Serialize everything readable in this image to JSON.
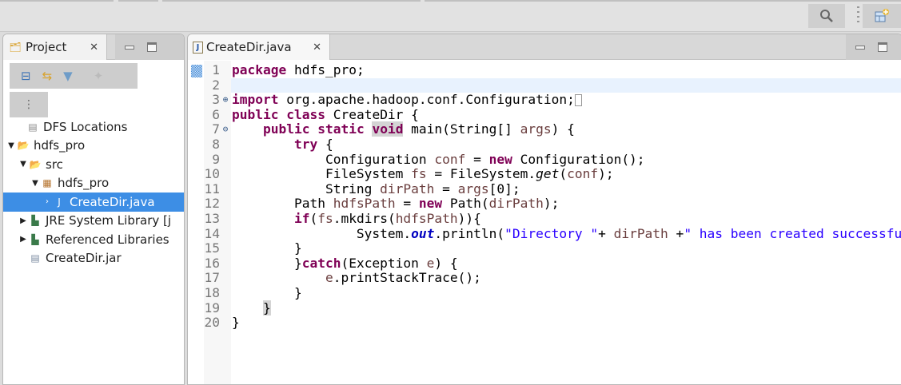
{
  "toolbar": {
    "search_icon": "search-icon",
    "perspective_icon": "open-perspective-icon"
  },
  "project_panel": {
    "tab_label": "Project",
    "close_icon": "close-icon",
    "tools": [
      "collapse-all-icon",
      "link-with-editor-icon",
      "filter-icon",
      "disabled-action-icon"
    ],
    "view_menu_icon": "view-menu-icon",
    "tree": [
      {
        "label": "DFS Locations",
        "level": 0,
        "arrow": "",
        "icon": "dfs-icon"
      },
      {
        "label": "hdfs_pro",
        "level": 0,
        "arrow": "▼",
        "icon": "project-folder-icon"
      },
      {
        "label": "src",
        "level": 1,
        "arrow": "▼",
        "icon": "source-folder-icon"
      },
      {
        "label": "hdfs_pro",
        "level": 2,
        "arrow": "▼",
        "icon": "package-icon"
      },
      {
        "label": "CreateDir.java",
        "level": 3,
        "arrow": "›",
        "icon": "java-file-icon",
        "selected": true
      },
      {
        "label": "JRE System Library [j",
        "level": 1,
        "arrow": "▶",
        "icon": "library-icon"
      },
      {
        "label": "Referenced Libraries",
        "level": 1,
        "arrow": "▶",
        "icon": "library-icon"
      },
      {
        "label": "CreateDir.jar",
        "level": 1,
        "arrow": "",
        "icon": "jar-file-icon"
      }
    ]
  },
  "editor": {
    "tab_label": "CreateDir.java",
    "current_line": "2",
    "lines": [
      {
        "n": "1",
        "fold": "",
        "t": [
          [
            "package",
            "kw"
          ],
          [
            " hdfs_pro;",
            ""
          ]
        ]
      },
      {
        "n": "2",
        "fold": "",
        "t": []
      },
      {
        "n": "3",
        "fold": "⊕",
        "t": [
          [
            "import",
            "kw"
          ],
          [
            " org.apache.hadoop.conf.Configuration;",
            ""
          ],
          [
            "",
            "box"
          ]
        ]
      },
      {
        "n": "6",
        "fold": "",
        "t": [
          [
            "public",
            "kw"
          ],
          [
            " ",
            ""
          ],
          [
            "class",
            "kw"
          ],
          [
            " CreateDir {",
            ""
          ]
        ]
      },
      {
        "n": "7",
        "fold": "⊖",
        "t": [
          [
            "    ",
            ""
          ],
          [
            "public",
            "kw"
          ],
          [
            " ",
            ""
          ],
          [
            "static",
            "kw"
          ],
          [
            " ",
            ""
          ],
          [
            "void",
            "kw occ"
          ],
          [
            " main(String[] ",
            ""
          ],
          [
            "args",
            "var"
          ],
          [
            ") {",
            ""
          ]
        ]
      },
      {
        "n": "8",
        "fold": "",
        "t": [
          [
            "        ",
            ""
          ],
          [
            "try",
            "kw"
          ],
          [
            " {",
            ""
          ]
        ]
      },
      {
        "n": "9",
        "fold": "",
        "t": [
          [
            "            Configuration ",
            ""
          ],
          [
            "conf",
            "var"
          ],
          [
            " = ",
            ""
          ],
          [
            "new",
            "kw"
          ],
          [
            " Configuration();",
            ""
          ]
        ]
      },
      {
        "n": "10",
        "fold": "",
        "t": [
          [
            "            FileSystem ",
            ""
          ],
          [
            "fs",
            "var"
          ],
          [
            " = FileSystem.",
            ""
          ],
          [
            "get",
            "it"
          ],
          [
            "(",
            ""
          ],
          [
            "conf",
            "var"
          ],
          [
            ");",
            ""
          ]
        ]
      },
      {
        "n": "11",
        "fold": "",
        "t": [
          [
            "            String ",
            ""
          ],
          [
            "dirPath",
            "var"
          ],
          [
            " = ",
            ""
          ],
          [
            "args",
            "var"
          ],
          [
            "[0];",
            ""
          ]
        ]
      },
      {
        "n": "12",
        "fold": "",
        "t": [
          [
            "        Path ",
            ""
          ],
          [
            "hdfsPath",
            "var"
          ],
          [
            " = ",
            ""
          ],
          [
            "new",
            "kw"
          ],
          [
            " Path(",
            ""
          ],
          [
            "dirPath",
            "var"
          ],
          [
            ");",
            ""
          ]
        ]
      },
      {
        "n": "13",
        "fold": "",
        "t": [
          [
            "        ",
            ""
          ],
          [
            "if",
            "kw"
          ],
          [
            "(",
            ""
          ],
          [
            "fs",
            "var"
          ],
          [
            ".mkdirs(",
            ""
          ],
          [
            "hdfsPath",
            "var"
          ],
          [
            ")){",
            ""
          ]
        ]
      },
      {
        "n": "14",
        "fold": "",
        "t": [
          [
            "                System.",
            ""
          ],
          [
            "out",
            "fld"
          ],
          [
            ".println(",
            ""
          ],
          [
            "\"Directory \"",
            "str"
          ],
          [
            "+ ",
            ""
          ],
          [
            "dirPath",
            "var"
          ],
          [
            " +",
            ""
          ],
          [
            "\" has been created successfully\"",
            "str"
          ],
          [
            ");",
            ""
          ]
        ]
      },
      {
        "n": "15",
        "fold": "",
        "t": [
          [
            "        }",
            ""
          ]
        ]
      },
      {
        "n": "16",
        "fold": "",
        "t": [
          [
            "        }",
            ""
          ],
          [
            "catch",
            "kw"
          ],
          [
            "(Exception ",
            ""
          ],
          [
            "e",
            "var"
          ],
          [
            ") {",
            ""
          ]
        ]
      },
      {
        "n": "17",
        "fold": "",
        "t": [
          [
            "            ",
            ""
          ],
          [
            "e",
            "var"
          ],
          [
            ".printStackTrace();",
            ""
          ]
        ]
      },
      {
        "n": "18",
        "fold": "",
        "t": [
          [
            "        }",
            ""
          ]
        ]
      },
      {
        "n": "19",
        "fold": "",
        "t": [
          [
            "    ",
            ""
          ],
          [
            "}",
            "occ"
          ]
        ]
      },
      {
        "n": "20",
        "fold": "",
        "t": [
          [
            "}",
            ""
          ]
        ]
      }
    ]
  }
}
